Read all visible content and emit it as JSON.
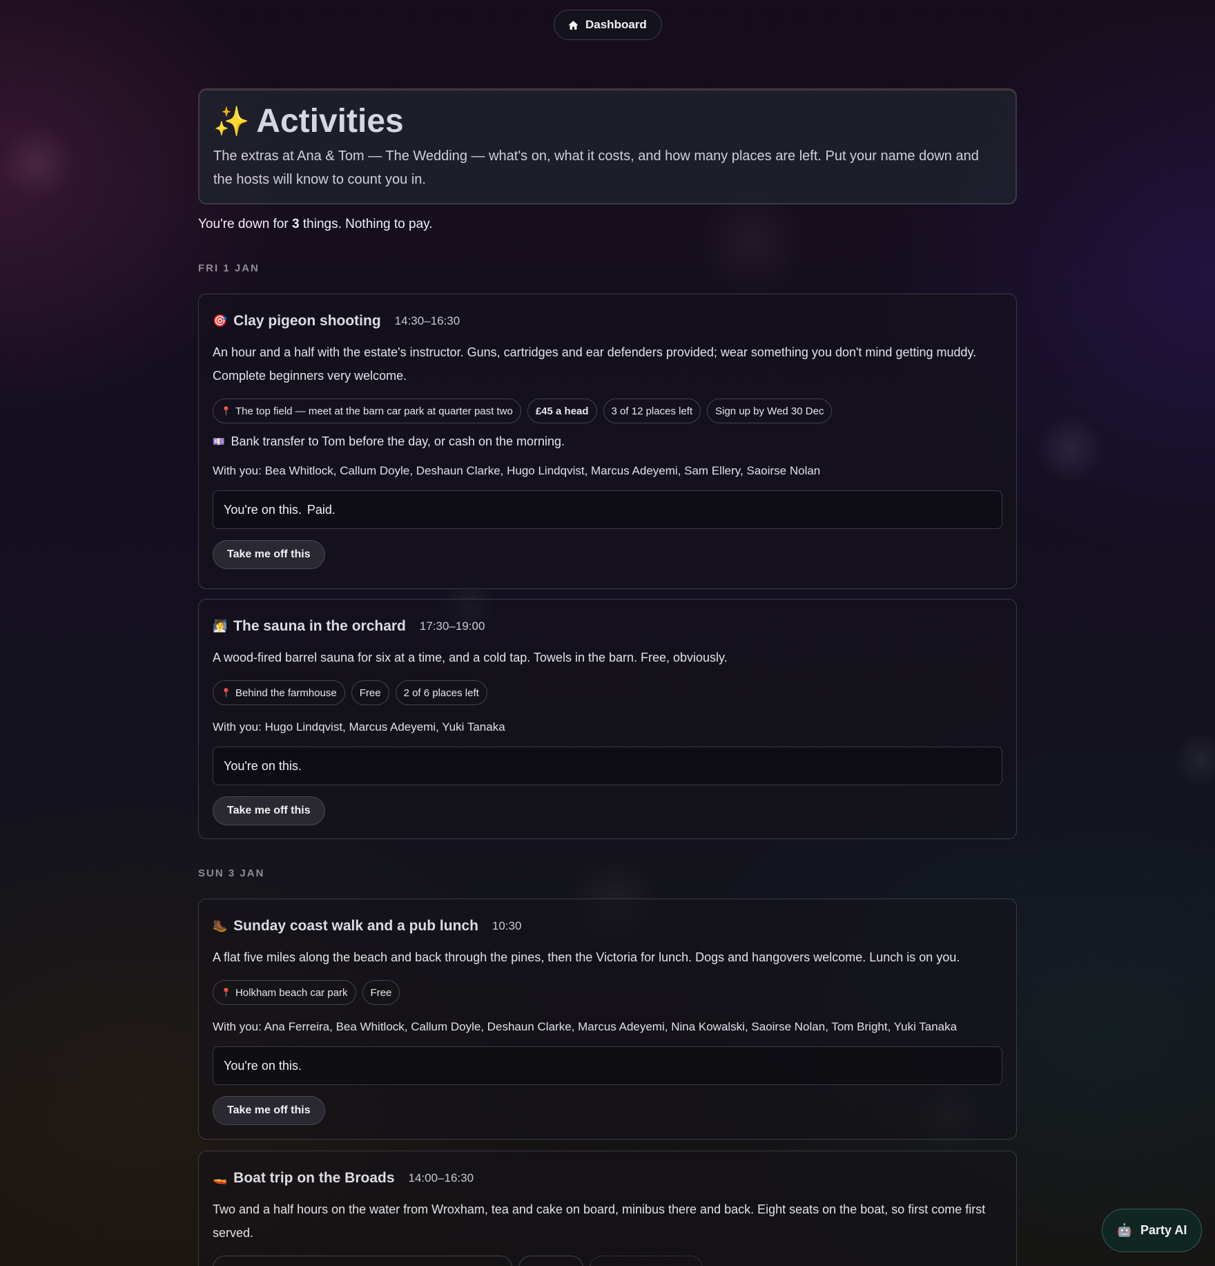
{
  "nav": {
    "dashboard_label": "Dashboard",
    "icon": "home-icon"
  },
  "header": {
    "sparkle": "✨",
    "title": "Activities",
    "subtitle": "The extras at Ana & Tom — The Wedding — what's on, what it costs, and how many places are left. Put your name down and the hosts will know to count you in."
  },
  "summary": {
    "prefix": "You're down for ",
    "count": "3",
    "suffix": " things. Nothing to pay."
  },
  "days": [
    {
      "label": "FRI 1 JAN"
    },
    {
      "label": "SUN 3 JAN"
    }
  ],
  "activities": [
    {
      "emoji": "🎯",
      "title": "Clay pigeon shooting",
      "time": "14:30–16:30",
      "description": "An hour and a half with the estate's instructor. Guns, cartridges and ear defenders provided; wear something you don't mind getting muddy. Complete beginners very welcome.",
      "location": "The top field — meet at the barn car park at quarter past two",
      "price": "£45 a head",
      "places": "3 of 12 places left",
      "deadline": "Sign up by Wed 30 Dec",
      "payment_note": "Bank transfer to Tom before the day, or cash on the morning.",
      "with_you": "With you: Bea Whitlock, Callum Doyle, Deshaun Clarke, Hugo Lindqvist, Marcus Adeyemi, Sam Ellery, Saoirse Nolan",
      "status": "You're on this.",
      "paid": "Paid.",
      "button": "Take me off this"
    },
    {
      "emoji": "🧖",
      "title": "The sauna in the orchard",
      "time": "17:30–19:00",
      "description": "A wood-fired barrel sauna for six at a time, and a cold tap. Towels in the barn. Free, obviously.",
      "location": "Behind the farmhouse",
      "price": "Free",
      "places": "2 of 6 places left",
      "with_you": "With you: Hugo Lindqvist, Marcus Adeyemi, Yuki Tanaka",
      "status": "You're on this.",
      "button": "Take me off this"
    },
    {
      "emoji": "🥾",
      "title": "Sunday coast walk and a pub lunch",
      "time": "10:30",
      "description": "A flat five miles along the beach and back through the pines, then the Victoria for lunch. Dogs and hangovers welcome. Lunch is on you.",
      "location": "Holkham beach car park",
      "price": "Free",
      "with_you": "With you: Ana Ferreira, Bea Whitlock, Callum Doyle, Deshaun Clarke, Marcus Adeyemi, Nina Kowalski, Saoirse Nolan, Tom Bright, Yuki Tanaka",
      "status": "You're on this.",
      "button": "Take me off this"
    },
    {
      "emoji": "🚤",
      "title": "Boat trip on the Broads",
      "time": "14:00–16:30",
      "description": "Two and a half hours on the water from Wroxham, tea and cake on board, minibus there and back. Eight seats on the boat, so first come first served."
    }
  ],
  "party_ai": {
    "label": "Party AI",
    "icon": "robot-icon"
  },
  "colors": {
    "accent_pin": "#e0485a",
    "background": "#150f1c"
  }
}
